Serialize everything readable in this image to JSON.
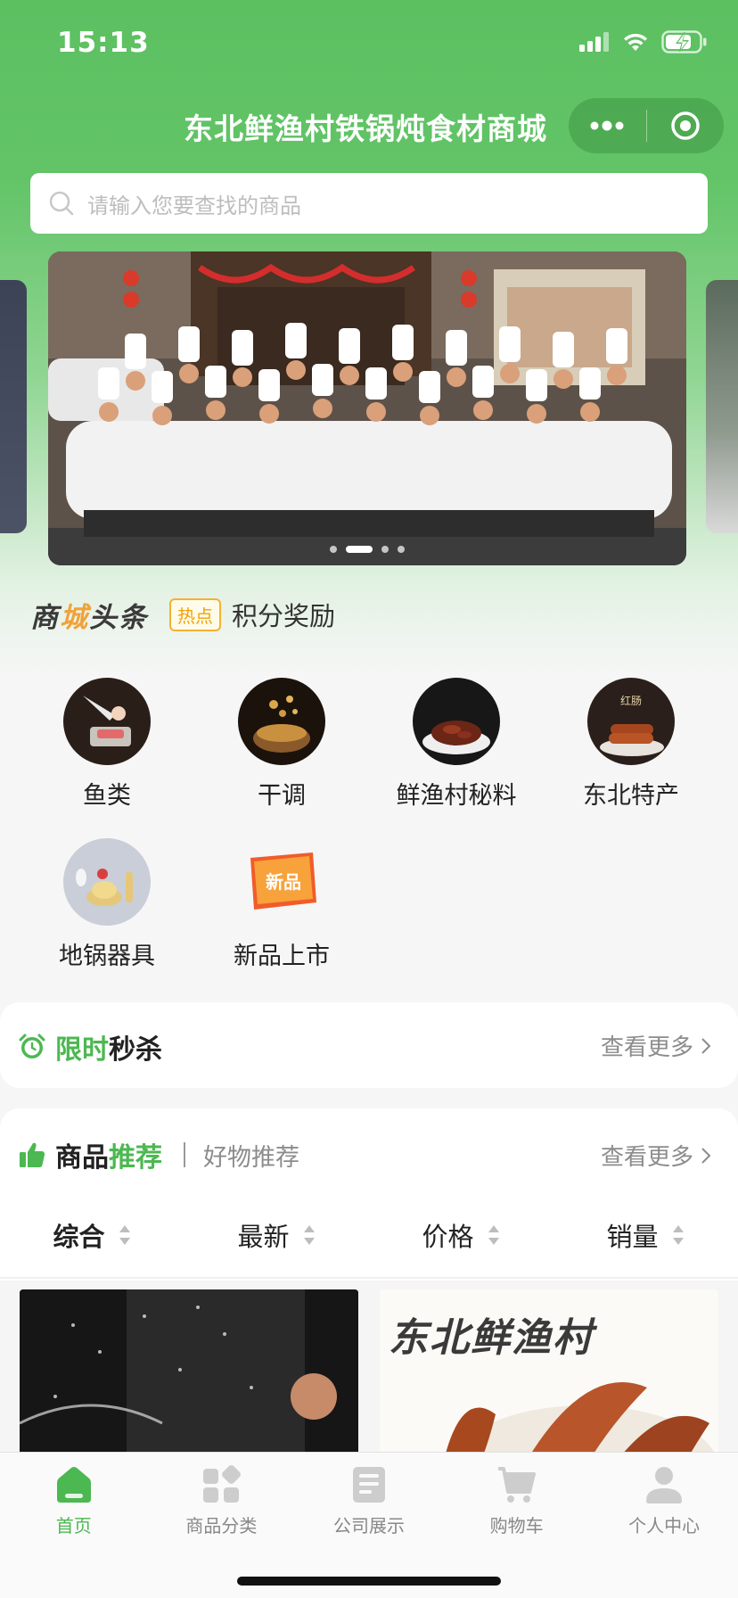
{
  "status_bar": {
    "time": "15:13"
  },
  "header": {
    "title": "东北鲜渔村铁锅炖食材商城"
  },
  "search": {
    "placeholder": "请输入您要查找的商品"
  },
  "banner": {
    "dot_count": 4,
    "active_dot": 1
  },
  "headline": {
    "logo_part1": "商",
    "logo_part2": "城",
    "logo_part3": "头条",
    "badge": "热点",
    "text": "积分奖励"
  },
  "categories": [
    {
      "label": "鱼类",
      "icon": "fish-category-icon"
    },
    {
      "label": "干调",
      "icon": "dried-seasoning-category-icon"
    },
    {
      "label": "鲜渔村秘料",
      "icon": "secret-sauce-category-icon"
    },
    {
      "label": "东北特产",
      "icon": "northeast-specialty-category-icon"
    },
    {
      "label": "地锅器具",
      "icon": "cookware-category-icon"
    },
    {
      "label": "新品上市",
      "icon": "new-products-category-icon"
    }
  ],
  "flash_sale": {
    "title_green": "限时",
    "title_black": "秒杀",
    "more": "查看更多"
  },
  "recommend": {
    "title_black": "商品",
    "title_green": "推荐",
    "subtitle": "好物推荐",
    "more": "查看更多"
  },
  "sort_options": [
    "综合",
    "最新",
    "价格",
    "销量"
  ],
  "products": {
    "p2_text": "东北鲜渔村"
  },
  "tabbar": [
    {
      "label": "首页",
      "icon": "home-icon",
      "active": true
    },
    {
      "label": "商品分类",
      "icon": "category-icon",
      "active": false
    },
    {
      "label": "公司展示",
      "icon": "company-icon",
      "active": false
    },
    {
      "label": "购物车",
      "icon": "cart-icon",
      "active": false
    },
    {
      "label": "个人中心",
      "icon": "profile-icon",
      "active": false
    }
  ],
  "colors": {
    "brand_green": "#5cc061",
    "accent_green": "#4cb851",
    "hot_orange": "#f2a20a"
  }
}
